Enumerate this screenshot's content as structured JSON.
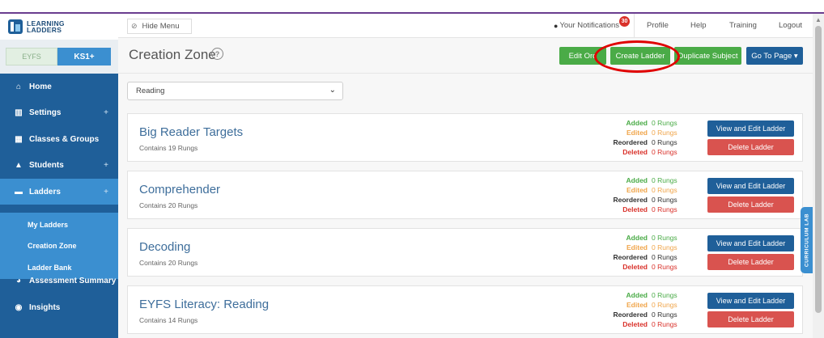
{
  "logo": {
    "line1": "LEARNING",
    "line2": "LADDERS"
  },
  "stage_toggle": {
    "eyfs": "EYFS",
    "ks1": "KS1+"
  },
  "sidebar": {
    "items": [
      {
        "label": "Home",
        "icon": "home-icon",
        "glyph": "⌂",
        "has_plus": false
      },
      {
        "label": "Settings",
        "icon": "bank-icon",
        "glyph": "▥",
        "has_plus": true
      },
      {
        "label": "Classes & Groups",
        "icon": "grid-icon",
        "glyph": "▦",
        "has_plus": false
      },
      {
        "label": "Students",
        "icon": "graduation-cap-icon",
        "glyph": "▲",
        "has_plus": true
      },
      {
        "label": "Ladders",
        "icon": "book-icon",
        "glyph": "▬",
        "has_plus": true
      },
      {
        "label": "Assessment Summary",
        "icon": "pie-chart-icon",
        "glyph": "◕",
        "has_plus": false
      },
      {
        "label": "Insights",
        "icon": "eye-icon",
        "glyph": "◉",
        "has_plus": false
      }
    ],
    "plus": "+",
    "sub_items": [
      "My Ladders",
      "Creation Zone",
      "Ladder Bank"
    ]
  },
  "topbar": {
    "hide_menu": "Hide Menu",
    "notifications": "Your Notifications",
    "notification_count": "30",
    "profile": "Profile",
    "help": "Help",
    "training": "Training",
    "logout": "Logout"
  },
  "page": {
    "title": "Creation Zone",
    "help_glyph": "?",
    "buttons": {
      "edit_order": "Edit Ord",
      "create_ladder": "Create Ladder",
      "duplicate_subject": "Duplicate Subject",
      "go_to_page": "Go To Page ▾"
    }
  },
  "subject_select": {
    "value": "Reading",
    "chevron": "⌄"
  },
  "stat_labels": {
    "added": "Added",
    "edited": "Edited",
    "reordered": "Reordered",
    "deleted": "Deleted"
  },
  "ladders": [
    {
      "title": "Big Reader Targets",
      "subtitle": "Contains 19 Rungs",
      "added": "0 Rungs",
      "edited": "0 Rungs",
      "reordered": "0 Rungs",
      "deleted": "0 Rungs"
    },
    {
      "title": "Comprehender",
      "subtitle": "Contains 20 Rungs",
      "added": "0 Rungs",
      "edited": "0 Rungs",
      "reordered": "0 Rungs",
      "deleted": "0 Rungs"
    },
    {
      "title": "Decoding",
      "subtitle": "Contains 20 Rungs",
      "added": "0 Rungs",
      "edited": "0 Rungs",
      "reordered": "0 Rungs",
      "deleted": "0 Rungs"
    },
    {
      "title": "EYFS Literacy: Reading",
      "subtitle": "Contains 14 Rungs",
      "added": "0 Rungs",
      "edited": "0 Rungs",
      "reordered": "0 Rungs",
      "deleted": "0 Rungs"
    }
  ],
  "card_buttons": {
    "view": "View and Edit Ladder",
    "delete": "Delete Ladder"
  },
  "curriculum_lab": "CURRICULUM LAB",
  "colors": {
    "sidebar": "#1f5f99",
    "accent_blue": "#3b8fd0",
    "green": "#4aab47",
    "red": "#d9312a",
    "highlight": "#e00000"
  }
}
